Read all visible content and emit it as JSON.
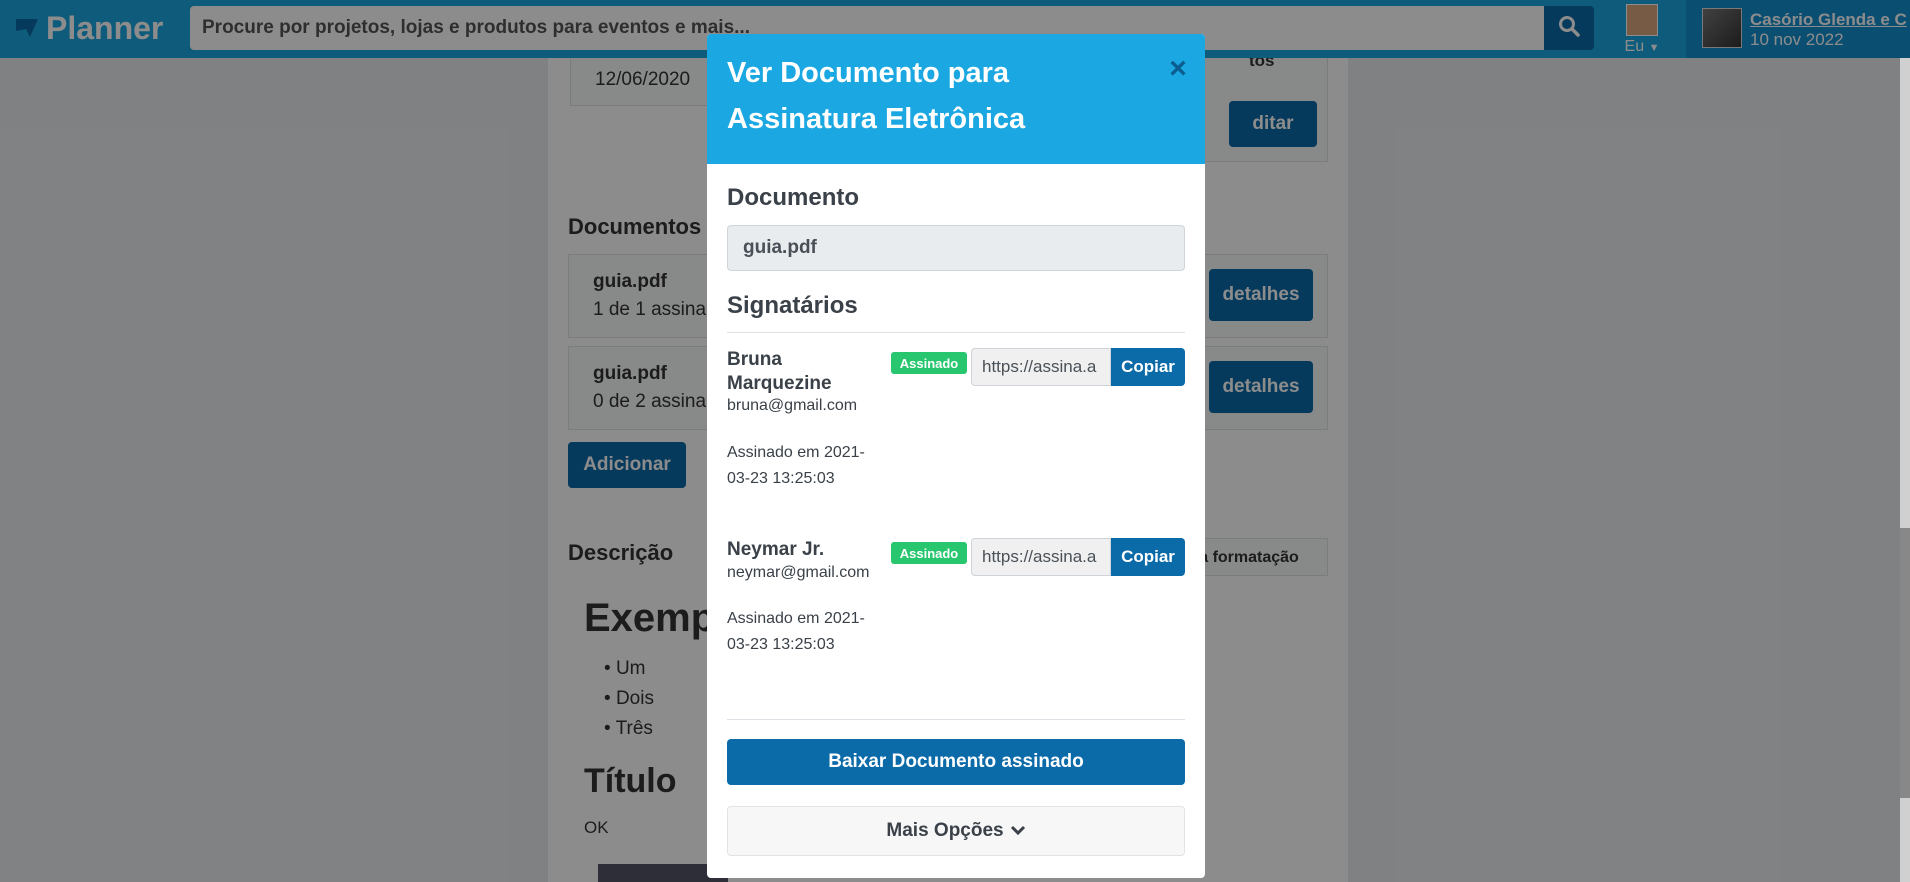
{
  "nav": {
    "brand": "Planner",
    "search_placeholder": "Procure por projetos, lojas e produtos para eventos e mais...",
    "user_label": "Eu",
    "event_name": "Casório Glenda e C",
    "event_date": "10 nov 2022"
  },
  "background": {
    "date_value": "12/06/2020",
    "edit_partial": "ditar",
    "tos_partial": "tos",
    "documents_heading": "Documentos",
    "documents": [
      {
        "name": "guia.pdf",
        "status": "1 de 1 assinar",
        "details_partial": "detalhes"
      },
      {
        "name": "guia.pdf",
        "status": "0 de 2 assina",
        "details_partial": "detalhes"
      }
    ],
    "add_button": "Adicionar",
    "description_heading": "Descrição",
    "formatting_partial": "ra formatação",
    "example_heading": "Exemp",
    "list_items": [
      "Um",
      "Dois",
      "Três"
    ],
    "title_heading": "Título",
    "ok_text": "OK"
  },
  "modal": {
    "title": "Ver Documento para Assinatura Eletrônica",
    "close_label": "×",
    "document_heading": "Documento",
    "document_name": "guia.pdf",
    "signers_heading": "Signatários",
    "signers": [
      {
        "name": "Bruna Marquezine",
        "email": "bruna@gmail.com",
        "status": "Assinado",
        "link": "https://assina.a",
        "copy_label": "Copiar",
        "signed_at": "Assinado em 2021-03-23 13:25:03"
      },
      {
        "name": "Neymar Jr.",
        "email": "neymar@gmail.com",
        "status": "Assinado",
        "link": "https://assina.a",
        "copy_label": "Copiar",
        "signed_at": "Assinado em 2021-03-23 13:25:03"
      }
    ],
    "download_label": "Baixar Documento assinado",
    "more_options_label": "Mais Opções"
  },
  "colors": {
    "header_blue": "#1ba7e1",
    "button_blue": "#0b6aa8",
    "badge_green": "#28c76f"
  }
}
